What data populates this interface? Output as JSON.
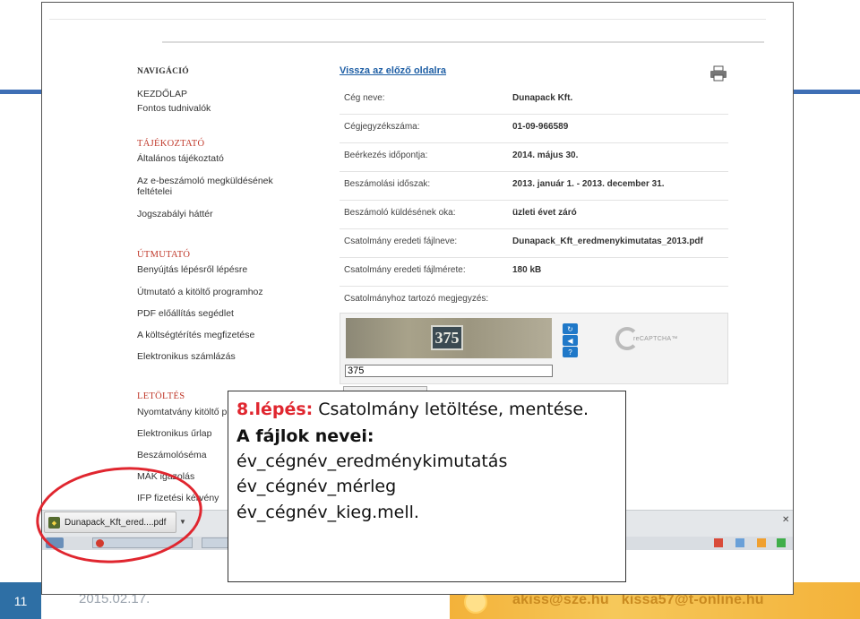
{
  "nav": {
    "heading": "NAVIGÁCIÓ",
    "home": "KEZDŐLAP",
    "info": "Fontos tudnivalók",
    "tajekoztato_head": "TÁJÉKOZTATÓ",
    "general": "Általános tájékoztató",
    "conditions": "Az e-beszámoló megküldésének feltételei",
    "legal": "Jogszabályi háttér",
    "utmutato_head": "ÚTMUTATÓ",
    "steps": "Benyújtás lépésről lépésre",
    "guide": "Útmutató a kitöltő programhoz",
    "pdf_helper": "PDF előállítás segédlet",
    "fees": "A költségtérítés megfizetése",
    "billing": "Elektronikus számlázás",
    "letoltes_head": "LETÖLTÉS",
    "nyomtatvany": "Nyomtatvány kitöltő pr",
    "eform": "Elektronikus űrlap",
    "schema": "Beszámolóséma",
    "mak": "MÁK igazolás",
    "ifp": "IFP fizetési kérvény"
  },
  "form": {
    "back_link": "Vissza az előző oldalra",
    "rows": [
      {
        "label": "Cég neve:",
        "value": "Dunapack Kft."
      },
      {
        "label": "Cégjegyzékszáma:",
        "value": "01-09-966589"
      },
      {
        "label": "Beérkezés időpontja:",
        "value": "2014. május 30."
      },
      {
        "label": "Beszámolási időszak:",
        "value": "2013. január 1. - 2013. december 31."
      },
      {
        "label": "Beszámoló küldésének oka:",
        "value": "üzleti évet záró"
      },
      {
        "label": "Csatolmány eredeti fájlneve:",
        "value": "Dunapack_Kft_eredmenykimutatas_2013.pdf"
      },
      {
        "label": "Csatolmány eredeti fájlmérete:",
        "value": "180 kB"
      },
      {
        "label": "Csatolmányhoz tartozó megjegyzés:",
        "value": ""
      }
    ],
    "captcha_plate": "375",
    "captcha_value": "375",
    "recaptcha_label": "reCAPTCHA™"
  },
  "download": {
    "filename": "Dunapack_Kft_ered....pdf"
  },
  "callout": {
    "step": "8.lépés:",
    "step_text": " Csatolmány letöltése, mentése.",
    "heading": "A fájlok nevei:",
    "line1": "év_cégnév_eredménykimutatás",
    "line2": "év_cégnév_mérleg",
    "line3": "év_cégnév_kieg.mell."
  },
  "footer": {
    "slide_number": "11",
    "date": "2015.02.17.",
    "email": "akiss@sze.hu   kissa57@t-online.hu"
  },
  "colors": {
    "accent_red": "#e0262f",
    "link_blue": "#1f5fa5",
    "slide_blue": "#2e6fa5",
    "footer_orange": "#f3b23a"
  }
}
